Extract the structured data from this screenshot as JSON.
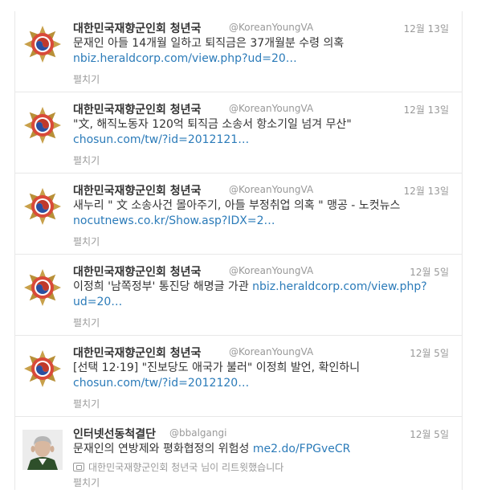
{
  "tweets": [
    {
      "name": "대한민국재향군인회 청년국",
      "handle": "@KoreanYoungVA",
      "time": "12월 13일",
      "text": "문재인 아들 14개월 일하고 퇴직금은 37개월분 수령 의혹",
      "link": "nbiz.heraldcorp.com/view.php?ud=20…",
      "expand": "펼치기",
      "avatar": "veterans-emblem"
    },
    {
      "name": "대한민국재향군인회 청년국",
      "handle": "@KoreanYoungVA",
      "time": "12월 13일",
      "text": "\"文, 해직노동자 120억 퇴직금 소송서 항소기일 넘겨 무산\"",
      "link": "chosun.com/tw/?id=2012121…",
      "expand": "펼치기",
      "avatar": "veterans-emblem"
    },
    {
      "name": "대한민국재향군인회 청년국",
      "handle": "@KoreanYoungVA",
      "time": "12월 13일",
      "text": "새누리 \" 文 소송사건 몰아주기, 아들 부정취업 의혹 \" 맹공 - 노컷뉴스",
      "link": "nocutnews.co.kr/Show.asp?IDX=2…",
      "expand": "펼치기",
      "avatar": "veterans-emblem"
    },
    {
      "name": "대한민국재향군인회 청년국",
      "handle": "@KoreanYoungVA",
      "time": "12월 5일",
      "text": "이정희 '남쪽정부' 통진당 해명글 가관",
      "link": "nbiz.heraldcorp.com/view.php?ud=20…",
      "expand": "펼치기",
      "avatar": "veterans-emblem"
    },
    {
      "name": "대한민국재향군인회 청년국",
      "handle": "@KoreanYoungVA",
      "time": "12월 5일",
      "text": "[선택 12·19] \"진보당도 애국가 불러\" 이정희 발언, 확인하니",
      "link": "chosun.com/tw/?id=2012120…",
      "expand": "펼치기",
      "avatar": "veterans-emblem"
    },
    {
      "name": "인터넷선동척결단",
      "handle": "@bbalgangi",
      "time": "12월 5일",
      "text": "문재인의 연방제와 평화협정의 위험성",
      "link": "me2.do/FPGveCR",
      "retweeted_by": "대한민국재향군인회 청년국 님이 리트윗했습니다",
      "expand": "펼치기",
      "avatar": "person-photo"
    }
  ]
}
